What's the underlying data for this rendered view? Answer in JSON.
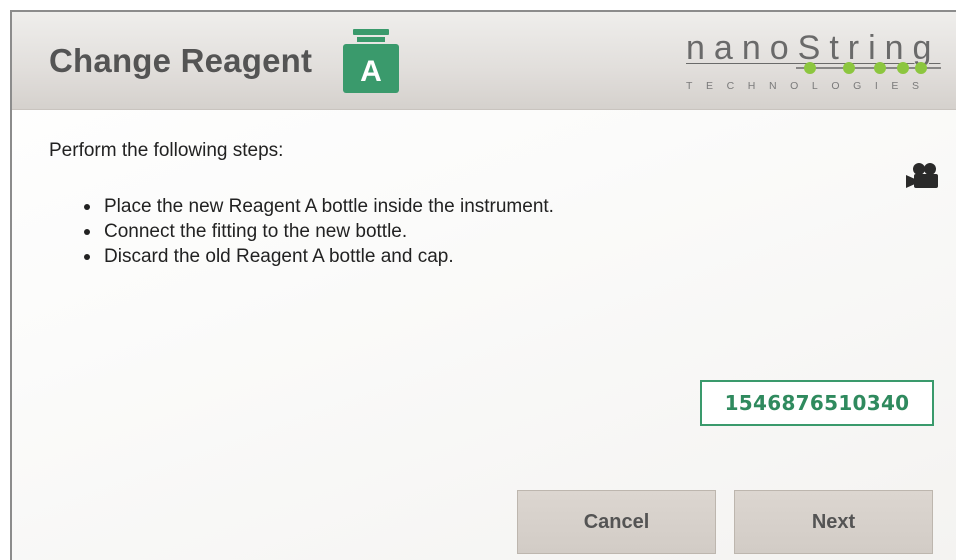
{
  "header": {
    "title": "Change Reagent",
    "reagent_badge": "A",
    "logo": {
      "brand": "nanoString",
      "tagline": "TECHNOLOGIES",
      "registered": "®"
    }
  },
  "content": {
    "intro": "Perform the following steps:",
    "steps": [
      "Place the new Reagent A bottle inside the instrument.",
      "Connect the fitting to the new bottle.",
      "Discard the old Reagent A bottle and cap."
    ],
    "video_icon": "video-camera-icon"
  },
  "barcode": {
    "value": "1546876510340"
  },
  "footer": {
    "cancel_label": "Cancel",
    "next_label": "Next"
  },
  "colors": {
    "accent_green": "#3a9a6c",
    "logo_dot_green": "#8cc63f",
    "header_gray": "#dcd8d4",
    "button_gray": "#d6d0ca"
  }
}
